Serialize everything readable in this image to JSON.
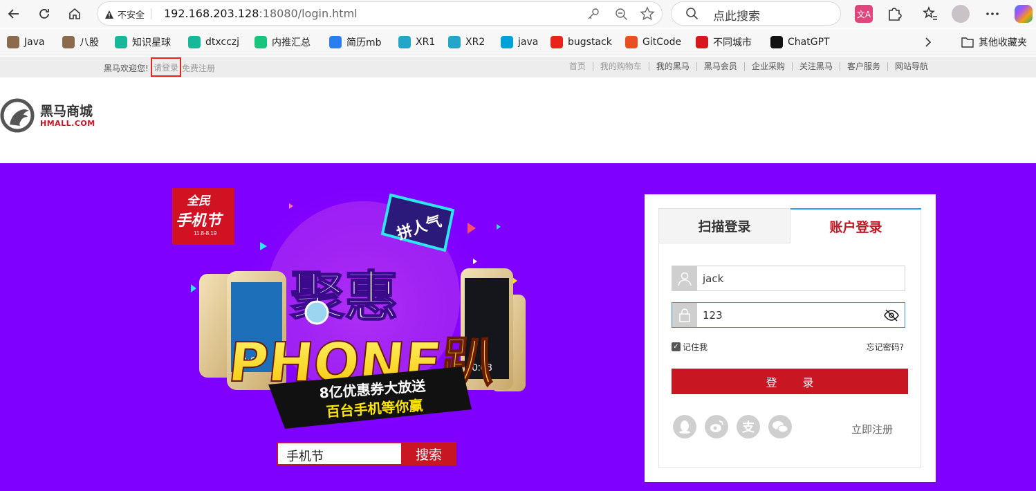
{
  "browser": {
    "security_label": "不安全",
    "url_host": "192.168.203.128",
    "url_path": ":18080/login.html",
    "search_placeholder": "点此搜索"
  },
  "bookmarks": [
    {
      "label": "Java",
      "color": "#8c6a4e"
    },
    {
      "label": "八股",
      "color": "#8c6a4e"
    },
    {
      "label": "知识星球",
      "color": "#17b897"
    },
    {
      "label": "dtxcczj",
      "color": "#17b897"
    },
    {
      "label": "内推汇总",
      "color": "#1bc47d"
    },
    {
      "label": "简历mb",
      "color": "#2b7ef0"
    },
    {
      "label": "XR1",
      "color": "#25a6c9"
    },
    {
      "label": "XR2",
      "color": "#25a6c9"
    },
    {
      "label": "java",
      "color": "#00a1d6"
    },
    {
      "label": "bugstack",
      "color": "#e8231b"
    },
    {
      "label": "GitCode",
      "color": "#e94e24"
    },
    {
      "label": "不同城市",
      "color": "#d8171d"
    },
    {
      "label": "ChatGPT",
      "color": "#111111"
    }
  ],
  "bookmarks_other": "其他收藏夹",
  "topbar": {
    "welcome": "黑马欢迎您!",
    "login": "请登录",
    "register": "免费注册",
    "nav": [
      "首页",
      "我的购物车",
      "我的黑马",
      "黑马会员",
      "企业采购",
      "关注黑马",
      "客户服务",
      "网站导航"
    ]
  },
  "logo": {
    "cn": "黑马商城",
    "en": "HMALL.COM"
  },
  "promo": {
    "badge_top": "全民",
    "badge_main": "手机节",
    "badge_date": "11.8-8.19",
    "ribbon": "拼人气",
    "headline": "聚惠",
    "headline2": "PHONE趴",
    "banner_line1": "8亿优惠券大放送",
    "banner_line2": "百台手机等你赢",
    "phone_time_left": "08:08",
    "phone_time_right": "10:08",
    "search_value": "手机节",
    "search_button": "搜索"
  },
  "login": {
    "tab_scan": "扫描登录",
    "tab_account": "账户登录",
    "username": "jack",
    "password": "123",
    "remember": "记住我",
    "forgot": "忘记密码?",
    "submit": "登 录",
    "register_now": "立即注册",
    "social": [
      "qq-icon",
      "weibo-icon",
      "alipay-icon",
      "wechat-icon"
    ]
  },
  "colors": {
    "brand_red": "#c81623",
    "hero_purple": "#7f00fe",
    "focus_blue": "#3a8fd9"
  }
}
